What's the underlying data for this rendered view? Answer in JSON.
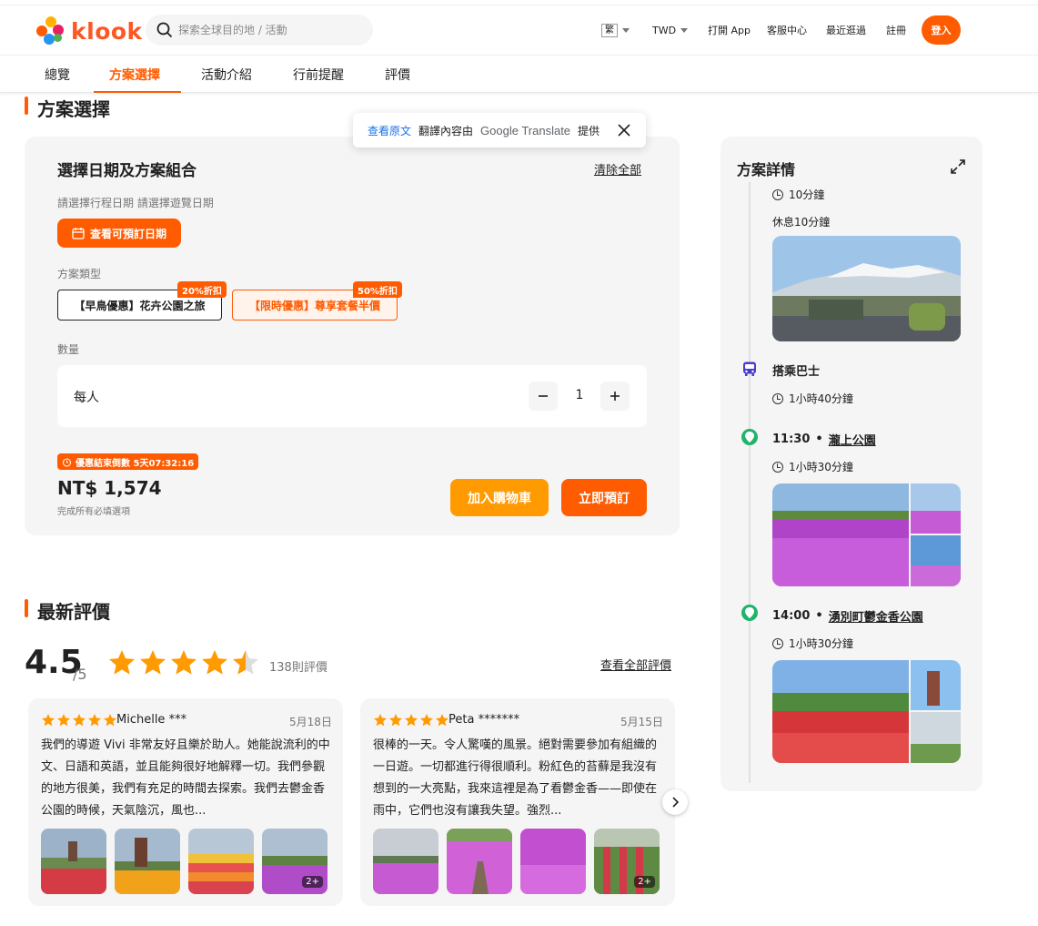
{
  "brand": {
    "name": "klook",
    "color": "#ff5b00"
  },
  "search": {
    "placeholder": "探索全球目的地 / 活動"
  },
  "nav": {
    "lang": "繁",
    "currency": "TWD",
    "open_app": "打開 App",
    "help": "客服中心",
    "recent": "最近逛過",
    "signup": "註冊",
    "login": "登入"
  },
  "tabs": [
    "總覽",
    "方案選擇",
    "活動介紹",
    "行前提醒",
    "評價"
  ],
  "translate": {
    "view_original": "查看原文",
    "text": "翻譯內容由",
    "google": "Google Translate",
    "provided": "提供"
  },
  "options": {
    "section_title": "方案選擇",
    "card_title": "選擇日期及方案組合",
    "clear_all": "清除全部",
    "hint": "請選擇行程日期 請選擇遊覽日期",
    "date_btn": "查看可預訂日期",
    "type_label": "方案類型",
    "packages": [
      {
        "label": "【早鳥優惠】花卉公園之旅",
        "discount": "20%折扣"
      },
      {
        "label": "【限時優惠】尊享套餐半價",
        "discount": "50%折扣"
      }
    ],
    "qty_label": "數量",
    "qty_unit": "每人",
    "qty_value": "1",
    "timer": "優惠結束倒數 5天07:32:16",
    "price": "NT$ 1,574",
    "price_note": "完成所有必填選項",
    "add_cart": "加入購物車",
    "book_now": "立即預訂"
  },
  "details": {
    "title": "方案詳情",
    "items": [
      {
        "duration": "10分鐘"
      },
      {
        "note": "休息10分鐘"
      },
      {
        "title": "搭乘巴士",
        "duration": "1小時40分鐘"
      },
      {
        "time": "11:30",
        "place": "瀧上公園",
        "duration": "1小時30分鐘"
      },
      {
        "time": "14:00",
        "place": "湧別町鬱金香公園",
        "duration": "1小時30分鐘"
      }
    ]
  },
  "reviews": {
    "section_title": "最新評價",
    "score": "4.5",
    "out_of": "/5",
    "rating": 4.5,
    "count": "138則評價",
    "view_all": "查看全部評價",
    "list": [
      {
        "name": "Michelle ***",
        "date": "5月18日",
        "body": "我們的導遊 Vivi 非常友好且樂於助人。她能說流利的中文、日語和英語，並且能夠很好地解釋一切。我們參觀的地方很美，我們有充足的時間去探索。我們去鬱金香公園的時候，天氣陰沉，風也...",
        "more": "2+"
      },
      {
        "name": "Peta *******",
        "date": "5月15日",
        "body": "很棒的一天。令人驚嘆的風景。絕對需要參加有組織的一日遊。一切都進行得很順利。粉紅色的苔蘚是我沒有想到的一大亮點，我來這裡是為了看鬱金香——即使在雨中，它們也沒有讓我失望。強烈...",
        "more": "2+"
      }
    ]
  },
  "colors": {
    "accent": "#ff5b00",
    "cart": "#ff9a00",
    "star": "#ff9a00",
    "pin": "#20b46b",
    "bus": "#4a3ccf"
  }
}
